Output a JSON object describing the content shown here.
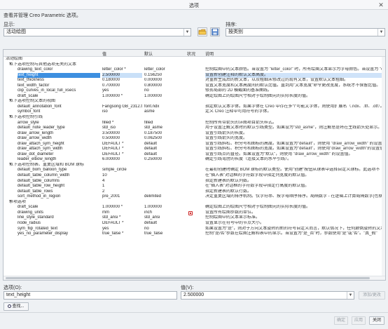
{
  "window": {
    "title": "选项",
    "close_glyph": "✕"
  },
  "description": "查看并管理 Creo Parametric 选项。",
  "show": {
    "label": "显示:",
    "value": "活动绘图"
  },
  "sort": {
    "label": "排序:",
    "value": "按类别"
  },
  "table": {
    "headers": {
      "name": "",
      "value": "值",
      "default": "默认",
      "status": "状况",
      "description": "说明"
    },
    "rows": [
      {
        "type": "top",
        "name": "活动绘图"
      },
      {
        "type": "cat",
        "name": "以下选项控制与其他选项无关的文本"
      },
      {
        "type": "opt",
        "name": "drawing_text_color",
        "value": "letter_color *",
        "default": "letter_color",
        "status": "ok",
        "desc": "控制绘图中的文本颜色。当设置为 \"letter_color\" 时，所有绘图文本显示为字母颜色。当设置为 \"e"
      },
      {
        "type": "opt",
        "name": "text_height",
        "value": "2.500000",
        "default": "0.156250",
        "status": "ok",
        "desc": "设置新创建注释的默认文本高度。",
        "selected": true
      },
      {
        "type": "opt",
        "name": "text_thickness",
        "value": "0.180000",
        "default": "0.000000",
        "status": "ok",
        "desc": "对重新生成后的新文本，以及粗细未修改过的现有文本，设置默认文本粗细。"
      },
      {
        "type": "opt",
        "name": "text_width_factor",
        "value": "0.700000",
        "default": "0.800000",
        "status": "ok",
        "desc": "设置文本宽度和文本高度间的默认比值。直到用\"文本宽度\"命令更改宽度，系统才不保留比值。"
      },
      {
        "type": "opt",
        "name": "clip_curves_in_local_full_xsecs",
        "value": "yes",
        "default": "no",
        "status": "ok",
        "desc": "修剪局部的 2D 横截面的基准曲线。"
      },
      {
        "type": "opt",
        "name": "draft_scale",
        "value": "1.000000 *",
        "default": "1.000000",
        "status": "ok",
        "desc": "确定绘图上的绘图尺寸相对于绘制图元的实际长度的值。"
      },
      {
        "type": "cat",
        "name": "以下选项控制文本的视图"
      },
      {
        "type": "opt",
        "name": "default_annotation_font",
        "value": "Fangsong GB_2312.ttf",
        "default": "font.ndx",
        "status": "ok",
        "desc": "指定默认文本字体。如果字体在 Creo 中存在多个可能文字体，则使用扩展名（.ndx、.ttf、.otf）。"
      },
      {
        "type": "opt",
        "name": "symbol_font",
        "value": "iso",
        "default": "asme",
        "status": "ok",
        "desc": "定义 Creo 注释中可用符号的字体。"
      },
      {
        "type": "cat",
        "name": "以下选项控制引线"
      },
      {
        "type": "opt",
        "name": "arrow_style",
        "value": "filled *",
        "default": "filled",
        "status": "ok",
        "desc": "控制所有带箭头的详图项目箭头样式。"
      },
      {
        "type": "opt",
        "name": "default_note_leader_type",
        "value": "std_iso",
        "default": "std_asme",
        "status": "ok",
        "desc": "用于设置注解文本时的默认引线类型。如果设为\"std_asme\"，则注解总是将在主线箭头处显示。"
      },
      {
        "type": "opt",
        "name": "draw_arrow_length",
        "value": "3.500000",
        "default": "0.187500",
        "status": "ok",
        "desc": "设置引线箭头的长度。"
      },
      {
        "type": "opt",
        "name": "draw_arrow_width",
        "value": "0.500000",
        "default": "0.062500",
        "status": "ok",
        "desc": "设置引线箭头的宽度。"
      },
      {
        "type": "opt",
        "name": "draw_attach_sym_height",
        "value": "DEFAULT *",
        "default": "default",
        "status": "ok",
        "desc": "设置引线斜杠、积分号和图标的高度。如果设置为\"default\"，则使用 \"draw_arrow_width\" 的设置值。"
      },
      {
        "type": "opt",
        "name": "draw_attach_sym_width",
        "value": "DEFAULT *",
        "default": "default",
        "status": "ok",
        "desc": "设置引线斜杠、积分号和图标的宽度。如果设置为\"default\"，则使用\"draw_arrow_width\"的设置值。"
      },
      {
        "type": "opt",
        "name": "draw_dot_diameter",
        "value": "DEFAULT *",
        "default": "default",
        "status": "ok",
        "desc": "设置引线点的直径。如果设置为\"默认\"，则使用 \"draw_arrow_width\" 的设置值。"
      },
      {
        "type": "opt",
        "name": "leader_elbow_length",
        "value": "6.000000",
        "default": "0.250000",
        "status": "ok",
        "desc": "确定引线弯肘的长度（连接文本的水平引线）。"
      },
      {
        "type": "cat",
        "name": "以下选项控制表、重复区域和 BOM 球标"
      },
      {
        "type": "opt",
        "name": "default_bom_balloon_type",
        "value": "simple_circle",
        "default": "",
        "status": "ok",
        "desc": "在最初创建时确定 BOM 球标的默认类型。使用\"创建\"按钮从球表中选择自定义球标。此选项不"
      },
      {
        "type": "opt",
        "name": "default_table_column_width",
        "value": "10",
        "default": "",
        "status": "ok",
        "desc": "在\"插入表\"对话框的字符数字段中指定列宽度的默认值。"
      },
      {
        "type": "opt",
        "name": "default_table_columns",
        "value": "4",
        "default": "",
        "status": "ok",
        "desc": "指定新建表的默认列数。"
      },
      {
        "type": "opt",
        "name": "default_table_row_height",
        "value": "1",
        "default": "",
        "status": "ok",
        "desc": "在\"插入表\"对话框的字符数字段中指定行高度的默认值。"
      },
      {
        "type": "opt",
        "name": "default_table_rows",
        "value": "2",
        "default": "",
        "status": "ok",
        "desc": "指定新建表的默认行数。"
      },
      {
        "type": "opt",
        "name": "sort_method_in_region",
        "value": "pre_2001",
        "default": "delimited",
        "status": "ok",
        "desc": "决定重复区域的排序机制。仅字符串、按字母顺序排序。局隔数字 - 在逻辑上计算局隔数字(也就是"
      },
      {
        "type": "cat",
        "name": "杂项选项"
      },
      {
        "type": "opt",
        "name": "draft_scale",
        "value": "1.000000 *",
        "default": "1.000000",
        "status": "ok",
        "desc": "确定绘图上的绘图尺寸相对于绘制图元的实际长度的值。"
      },
      {
        "type": "opt",
        "name": "drawing_units",
        "value": "mm",
        "default": "inch",
        "status": "warn",
        "desc": "设置所有绘图参数的单位。"
      },
      {
        "type": "opt",
        "name": "line_style_standard",
        "value": "std_ansi *",
        "default": "std_ansi",
        "status": "ok",
        "desc": "控制绘图中的文本显示标准。"
      },
      {
        "type": "opt",
        "name": "node_radius",
        "value": "DEFAULT *",
        "default": "default",
        "status": "ok",
        "desc": "设置显示在符号中的节点大小。"
      },
      {
        "type": "opt",
        "name": "sym_flip_rotated_text",
        "value": "yes",
        "default": "no",
        "status": "ok",
        "desc": "如果设置为\"是\"，则对于方向文本旋转的新的符号自定义而言，默认情况下，任何颠倒旋转的文本都"
      },
      {
        "type": "opt",
        "name": "yes_no_parameter_display",
        "value": "true_false *",
        "default": "true_false",
        "status": "ok",
        "desc": "控制\"是/否\"参数在绘图注解和表中的显示。当设置为\"是_否\"时，参数使用\"是\"或\"否\"。\"真_假\""
      }
    ]
  },
  "option_field": {
    "label": "选项(O):",
    "value": "text_height"
  },
  "value_field": {
    "label": "值(V):",
    "value": "2.500000"
  },
  "add_change_button": "添加/更改",
  "find_button": "查找...",
  "footer": {
    "ok": "确定",
    "apply": "应用",
    "close": "关闭"
  },
  "status_colors": {
    "ok": "#1f9a4a",
    "warn": "#cc2222"
  }
}
